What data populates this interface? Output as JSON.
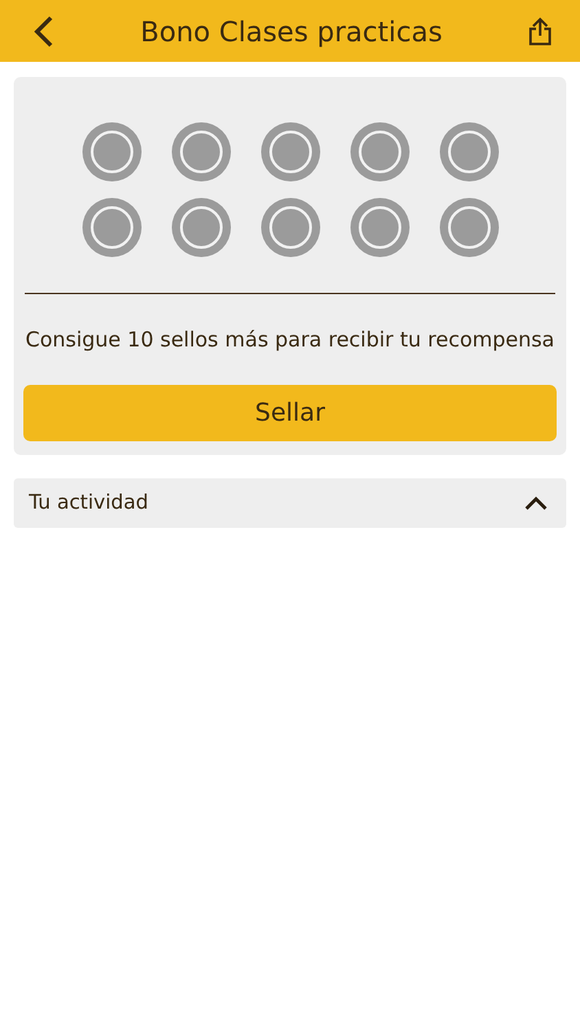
{
  "header": {
    "title": "Bono Clases practicas"
  },
  "stamps": [
    {
      "stamped": false
    },
    {
      "stamped": false
    },
    {
      "stamped": false
    },
    {
      "stamped": false
    },
    {
      "stamped": false
    },
    {
      "stamped": false
    },
    {
      "stamped": false
    },
    {
      "stamped": false
    },
    {
      "stamped": false
    },
    {
      "stamped": false
    }
  ],
  "message": "Consigue 10 sellos más para recibir tu recompensa",
  "stamp_button": "Sellar",
  "activity": {
    "label": "Tu actividad",
    "expanded": true
  }
}
